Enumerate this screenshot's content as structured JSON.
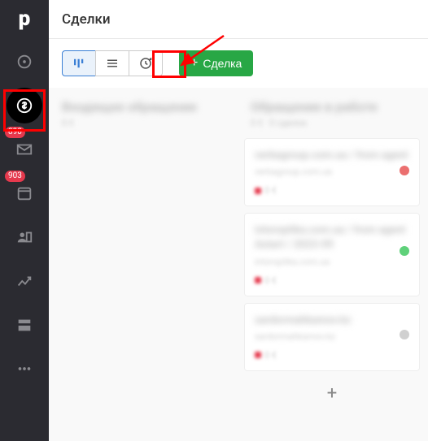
{
  "sidebar": {
    "logo": "p",
    "badges": {
      "mail": "890",
      "calendar": "903"
    }
  },
  "header": {
    "title": "Сделки"
  },
  "toolbar": {
    "add_label": "Сделка",
    "add_plus": "+"
  },
  "columns": [
    {
      "title": "Входящее обращение",
      "subtitle": "0 €",
      "cards": []
    },
    {
      "title": "Обращение в работе",
      "subtitle": "0 € · 0 сделок",
      "cards": [
        {
          "line1": "verbagroup.com.ua / from agent",
          "line2": "verbagroup.com.ua",
          "meta": "0 €",
          "color": "red"
        },
        {
          "line1": "intoroptika.com.ua / from agent Astart / 2023-09",
          "line2": "intoroptika.com.ua",
          "meta": "0 €",
          "color": "green"
        },
        {
          "line1": "sardormahkamov.kz",
          "line2": "sardormahkamov.kz",
          "meta": "0 €",
          "color": "gray"
        }
      ]
    }
  ],
  "add_card_symbol": "+"
}
